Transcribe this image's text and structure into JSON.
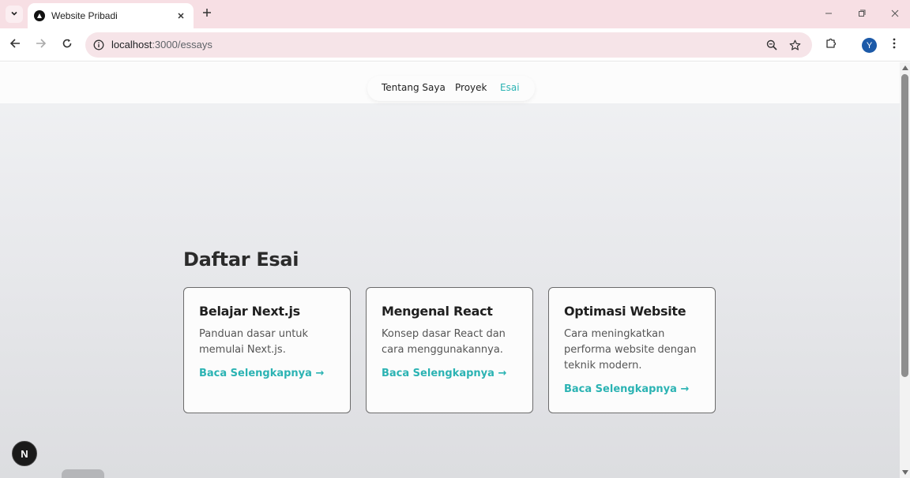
{
  "browser": {
    "tab_title": "Website Pribadi",
    "url_host": "localhost",
    "url_path": ":3000/essays",
    "profile_initial": "Y"
  },
  "icons": {
    "tab_menu": "chevron-down-icon",
    "favicon": "nextjs-triangle-icon",
    "tab_close": "close-icon",
    "new_tab": "plus-icon",
    "minimize": "minimize-icon",
    "restore": "restore-icon",
    "window_close": "close-icon",
    "back": "arrow-left-icon",
    "forward": "arrow-right-icon",
    "reload": "reload-icon",
    "site_info": "info-icon",
    "zoom": "zoom-icon",
    "bookmark": "star-icon",
    "extensions": "puzzle-icon",
    "menu": "kebab-menu-icon"
  },
  "site_nav": {
    "items": [
      {
        "label": "Tentang Saya",
        "active": false
      },
      {
        "label": "Proyek",
        "active": false
      },
      {
        "label": "Esai",
        "active": true
      }
    ]
  },
  "main": {
    "title": "Daftar Esai",
    "cards": [
      {
        "title": "Belajar Next.js",
        "description": "Panduan dasar untuk memulai Next.js.",
        "link": "Baca Selengkapnya →"
      },
      {
        "title": "Mengenal React",
        "description": "Konsep dasar React dan cara menggunakannya.",
        "link": "Baca Selengkapnya →"
      },
      {
        "title": "Optimasi Website",
        "description": "Cara meningkatkan performa website dengan teknik modern.",
        "link": "Baca Selengkapnya →"
      }
    ]
  },
  "dev_badge": {
    "label": "N"
  },
  "colors": {
    "accent": "#2bb3b3",
    "tabstrip": "#f7dfe4",
    "omnibox": "#f6e4e8",
    "profile": "#1c5aa8"
  }
}
